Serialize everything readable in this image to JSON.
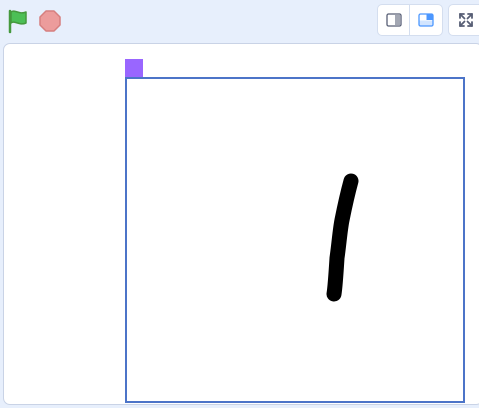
{
  "toolbar": {
    "green_flag_icon": "green-flag-icon",
    "stop_icon": "stop-icon",
    "small_stage_icon": "small-stage-icon",
    "normal_stage_icon": "normal-stage-icon",
    "fullscreen_icon": "fullscreen-icon"
  },
  "colors": {
    "background": "#e7effc",
    "flag_green": "#4cbf56",
    "stop_red": "#ec9c9c",
    "selected_blue": "#4c97ff",
    "canvas_border": "#4c74c8",
    "sprite_purple": "#9966ff",
    "pen_stroke": "#000000"
  }
}
